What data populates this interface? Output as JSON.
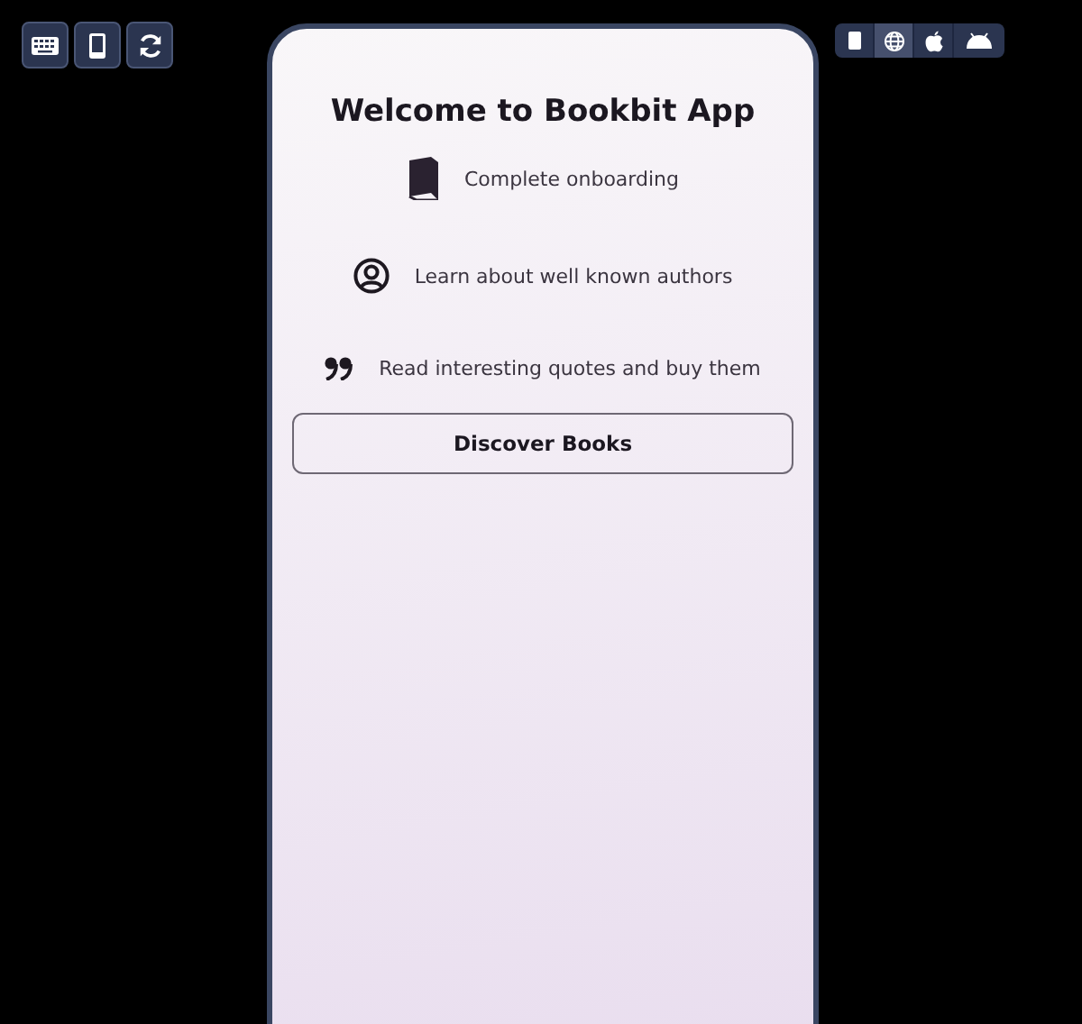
{
  "tools": [
    {
      "kind": "keyboard"
    },
    {
      "kind": "phone"
    },
    {
      "kind": "refresh"
    }
  ],
  "platforms": [
    {
      "kind": "phone",
      "selected": false
    },
    {
      "kind": "web",
      "selected": true
    },
    {
      "kind": "apple",
      "selected": false
    },
    {
      "kind": "android",
      "selected": false
    }
  ],
  "screen": {
    "title": "Welcome to Bookbit App",
    "features": [
      {
        "kind": "book",
        "label": "Complete onboarding"
      },
      {
        "kind": "person",
        "label": "Learn about well known authors"
      },
      {
        "kind": "quote",
        "label": "Read interesting quotes and buy them"
      }
    ],
    "button": "Discover Books"
  }
}
